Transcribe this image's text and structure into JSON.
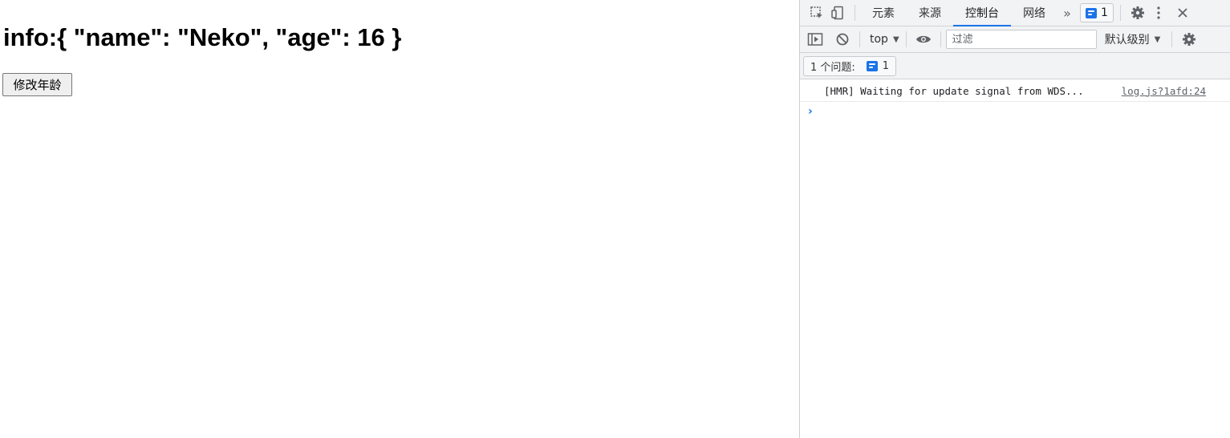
{
  "page": {
    "heading": "info:{ \"name\": \"Neko\", \"age\": 16 }",
    "button_label": "修改年龄"
  },
  "devtools": {
    "tabs": [
      {
        "label": "元素",
        "active": false
      },
      {
        "label": "来源",
        "active": false
      },
      {
        "label": "控制台",
        "active": true
      },
      {
        "label": "网络",
        "active": false
      }
    ],
    "more_tabs": "»",
    "issues_badge_count": "1",
    "toolbar": {
      "context": "top",
      "filter_placeholder": "过滤",
      "levels_label": "默认级别"
    },
    "issues": {
      "label": "1 个问题:",
      "count": "1"
    },
    "console": {
      "messages": [
        {
          "text": "[HMR] Waiting for update signal from WDS...",
          "source": "log.js?1afd:24"
        }
      ],
      "prompt": "›"
    },
    "colors": {
      "accent": "#1a73e8",
      "toolbar_bg": "#f1f3f4",
      "border": "#d0d3d7"
    },
    "icons": [
      "inspect-element-icon",
      "device-toggle-icon",
      "settings-gear-icon",
      "kebab-menu-icon",
      "close-icon",
      "sidebar-toggle-icon",
      "clear-console-icon",
      "live-expression-eye-icon",
      "console-settings-gear-icon",
      "message-icon"
    ]
  }
}
